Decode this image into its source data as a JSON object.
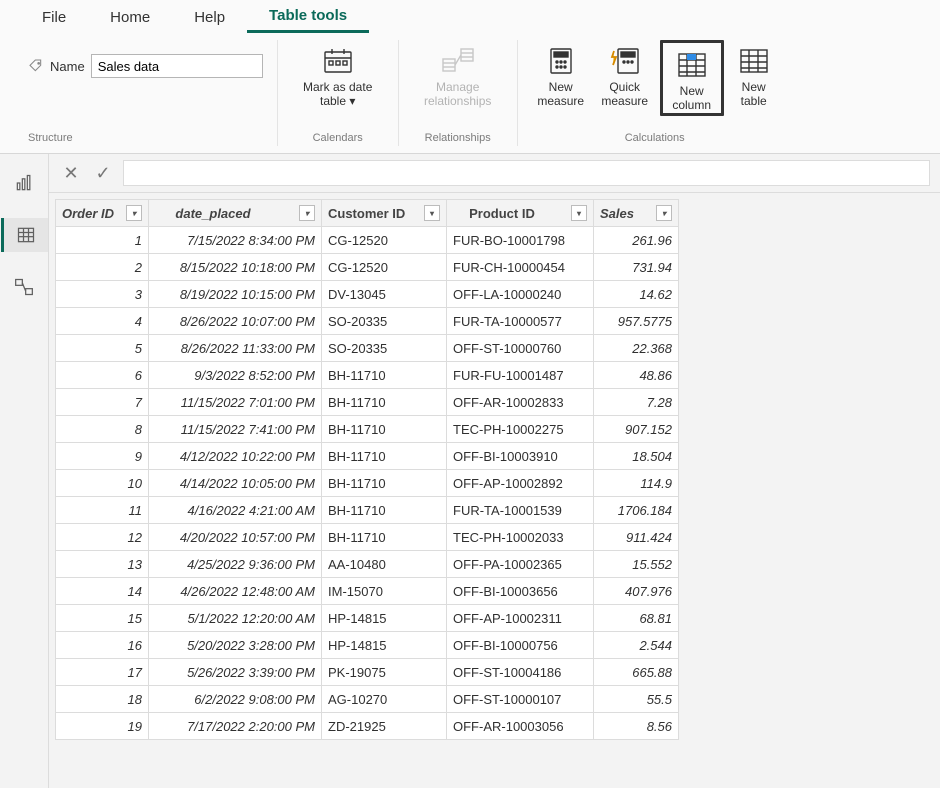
{
  "menu": {
    "file": "File",
    "home": "Home",
    "help": "Help",
    "table_tools": "Table tools"
  },
  "ribbon": {
    "structure": {
      "name_label": "Name",
      "name_value": "Sales data",
      "group_label": "Structure"
    },
    "calendars": {
      "mark_date_label_1": "Mark as date",
      "mark_date_label_2": "table",
      "group_label": "Calendars"
    },
    "relationships": {
      "manage_label_1": "Manage",
      "manage_label_2": "relationships",
      "group_label": "Relationships"
    },
    "calculations": {
      "new_measure_1": "New",
      "new_measure_2": "measure",
      "quick_measure_1": "Quick",
      "quick_measure_2": "measure",
      "new_column_1": "New",
      "new_column_2": "column",
      "new_table_1": "New",
      "new_table_2": "table",
      "group_label": "Calculations"
    }
  },
  "table": {
    "headers": {
      "order_id": "Order ID",
      "date_placed": "date_placed",
      "customer_id": "Customer ID",
      "product_id": "Product ID",
      "sales": "Sales"
    },
    "rows": [
      {
        "order_id": "1",
        "date_placed": "7/15/2022 8:34:00 PM",
        "customer_id": "CG-12520",
        "product_id": "FUR-BO-10001798",
        "sales": "261.96"
      },
      {
        "order_id": "2",
        "date_placed": "8/15/2022 10:18:00 PM",
        "customer_id": "CG-12520",
        "product_id": "FUR-CH-10000454",
        "sales": "731.94"
      },
      {
        "order_id": "3",
        "date_placed": "8/19/2022 10:15:00 PM",
        "customer_id": "DV-13045",
        "product_id": "OFF-LA-10000240",
        "sales": "14.62"
      },
      {
        "order_id": "4",
        "date_placed": "8/26/2022 10:07:00 PM",
        "customer_id": "SO-20335",
        "product_id": "FUR-TA-10000577",
        "sales": "957.5775"
      },
      {
        "order_id": "5",
        "date_placed": "8/26/2022 11:33:00 PM",
        "customer_id": "SO-20335",
        "product_id": "OFF-ST-10000760",
        "sales": "22.368"
      },
      {
        "order_id": "6",
        "date_placed": "9/3/2022 8:52:00 PM",
        "customer_id": "BH-11710",
        "product_id": "FUR-FU-10001487",
        "sales": "48.86"
      },
      {
        "order_id": "7",
        "date_placed": "11/15/2022 7:01:00 PM",
        "customer_id": "BH-11710",
        "product_id": "OFF-AR-10002833",
        "sales": "7.28"
      },
      {
        "order_id": "8",
        "date_placed": "11/15/2022 7:41:00 PM",
        "customer_id": "BH-11710",
        "product_id": "TEC-PH-10002275",
        "sales": "907.152"
      },
      {
        "order_id": "9",
        "date_placed": "4/12/2022 10:22:00 PM",
        "customer_id": "BH-11710",
        "product_id": "OFF-BI-10003910",
        "sales": "18.504"
      },
      {
        "order_id": "10",
        "date_placed": "4/14/2022 10:05:00 PM",
        "customer_id": "BH-11710",
        "product_id": "OFF-AP-10002892",
        "sales": "114.9"
      },
      {
        "order_id": "11",
        "date_placed": "4/16/2022 4:21:00 AM",
        "customer_id": "BH-11710",
        "product_id": "FUR-TA-10001539",
        "sales": "1706.184"
      },
      {
        "order_id": "12",
        "date_placed": "4/20/2022 10:57:00 PM",
        "customer_id": "BH-11710",
        "product_id": "TEC-PH-10002033",
        "sales": "911.424"
      },
      {
        "order_id": "13",
        "date_placed": "4/25/2022 9:36:00 PM",
        "customer_id": "AA-10480",
        "product_id": "OFF-PA-10002365",
        "sales": "15.552"
      },
      {
        "order_id": "14",
        "date_placed": "4/26/2022 12:48:00 AM",
        "customer_id": "IM-15070",
        "product_id": "OFF-BI-10003656",
        "sales": "407.976"
      },
      {
        "order_id": "15",
        "date_placed": "5/1/2022 12:20:00 AM",
        "customer_id": "HP-14815",
        "product_id": "OFF-AP-10002311",
        "sales": "68.81"
      },
      {
        "order_id": "16",
        "date_placed": "5/20/2022 3:28:00 PM",
        "customer_id": "HP-14815",
        "product_id": "OFF-BI-10000756",
        "sales": "2.544"
      },
      {
        "order_id": "17",
        "date_placed": "5/26/2022 3:39:00 PM",
        "customer_id": "PK-19075",
        "product_id": "OFF-ST-10004186",
        "sales": "665.88"
      },
      {
        "order_id": "18",
        "date_placed": "6/2/2022 9:08:00 PM",
        "customer_id": "AG-10270",
        "product_id": "OFF-ST-10000107",
        "sales": "55.5"
      },
      {
        "order_id": "19",
        "date_placed": "7/17/2022 2:20:00 PM",
        "customer_id": "ZD-21925",
        "product_id": "OFF-AR-10003056",
        "sales": "8.56"
      }
    ]
  }
}
